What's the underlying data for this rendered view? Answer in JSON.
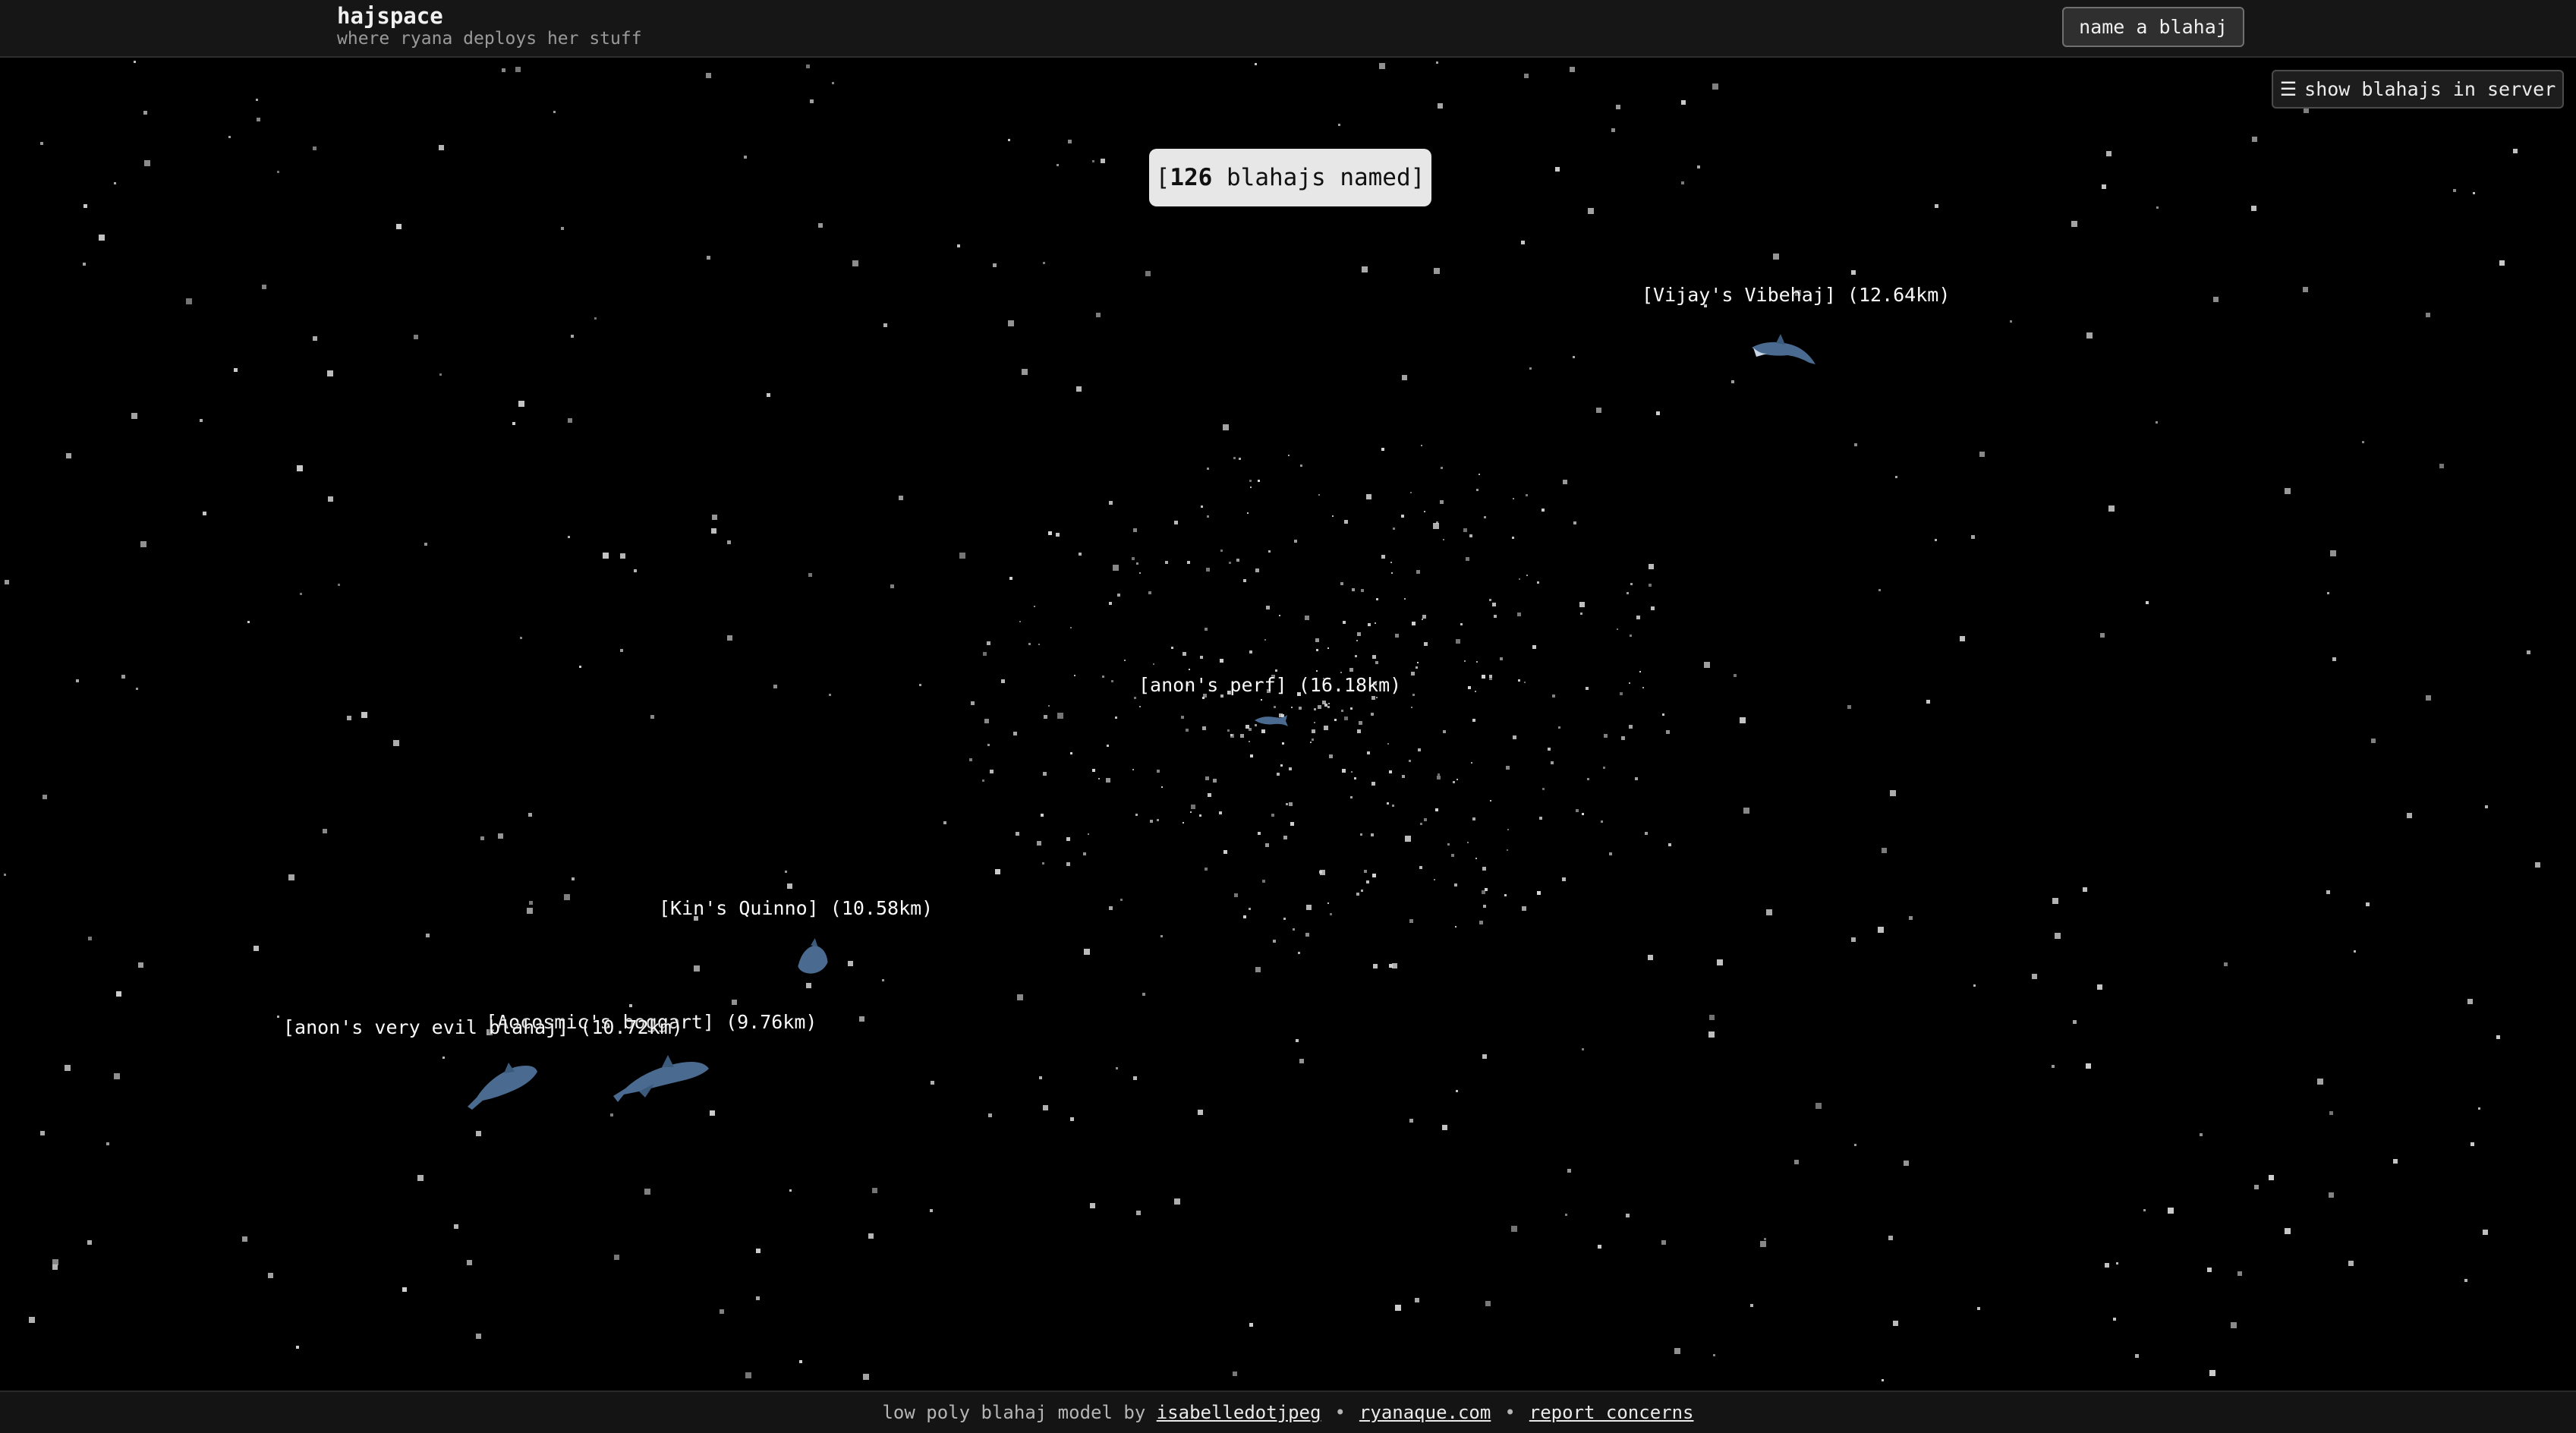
{
  "header": {
    "title": "hajspace",
    "subtitle": "where ryana deploys her stuff",
    "name_button": "name a blahaj"
  },
  "server_toggle": {
    "icon": "menu-icon",
    "label": "show blahajs in server"
  },
  "counter": {
    "open": "[",
    "count": "126",
    "text": " blahajs named]"
  },
  "blahajs": [
    {
      "label": "[Vijay's Vibehaj] (12.64km)"
    },
    {
      "label": "[anon's perf] (16.18km)"
    },
    {
      "label": "[Kin's Quinno] (10.58km)"
    },
    {
      "label": "[Aocosmic's boggart] (9.76km)"
    },
    {
      "label": "[anon's very evil blahaj] (10.72km)"
    }
  ],
  "footer": {
    "credit_prefix": "low poly blahaj model by ",
    "credit_link": "isabelledotjpeg",
    "separator": "•",
    "site_link": "ryanaque.com",
    "report_link": "report concerns"
  },
  "colors": {
    "background": "#000000",
    "shark": "#4a6a8f",
    "badge": "#e7e7e7"
  }
}
